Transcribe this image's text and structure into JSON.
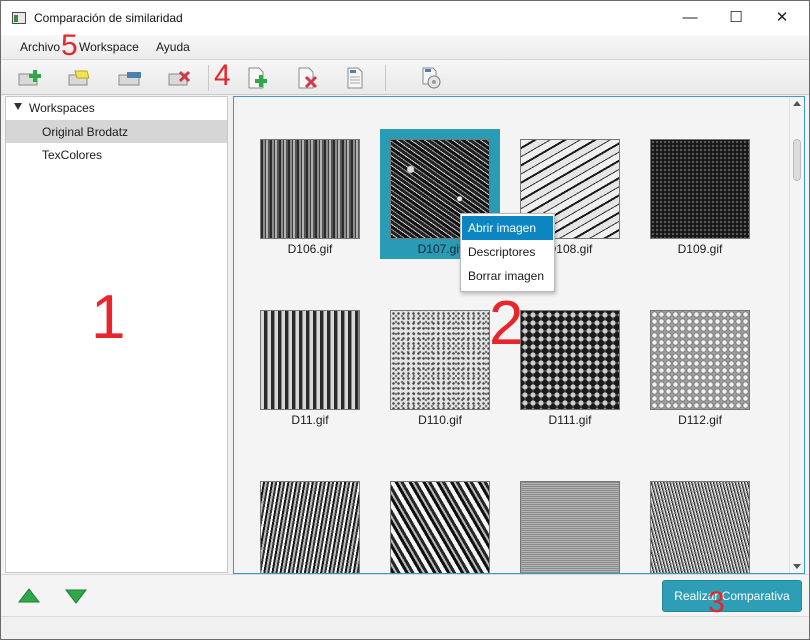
{
  "window": {
    "title": "Comparación de similaridad",
    "minimize_glyph": "—",
    "maximize_glyph": "☐",
    "close_glyph": "✕"
  },
  "menu": {
    "items": [
      {
        "label": "Archivo"
      },
      {
        "label": "Workspace"
      },
      {
        "label": "Ayuda"
      }
    ]
  },
  "toolbar": {
    "buttons": [
      {
        "icon": "add-workspace-icon"
      },
      {
        "icon": "open-folder-icon"
      },
      {
        "icon": "edit-workspace-icon"
      },
      {
        "icon": "delete-workspace-icon"
      },
      {
        "icon": "add-image-icon"
      },
      {
        "icon": "delete-image-icon"
      },
      {
        "icon": "document-icon"
      },
      {
        "icon": "compare-tool-icon"
      }
    ]
  },
  "tree": {
    "root_label": "Workspaces",
    "items": [
      {
        "label": "Original Brodatz",
        "selected": true
      },
      {
        "label": "TexColores",
        "selected": false
      }
    ]
  },
  "gallery": {
    "images": [
      {
        "caption": "D106.gif",
        "selected": false
      },
      {
        "caption": "D107.gif",
        "selected": true
      },
      {
        "caption": "D108.gif",
        "selected": false
      },
      {
        "caption": "D109.gif",
        "selected": false
      },
      {
        "caption": "D11.gif",
        "selected": false
      },
      {
        "caption": "D110.gif",
        "selected": false
      },
      {
        "caption": "D111.gif",
        "selected": false
      },
      {
        "caption": "D112.gif",
        "selected": false
      },
      {
        "caption": "",
        "selected": false
      },
      {
        "caption": "",
        "selected": false
      },
      {
        "caption": "",
        "selected": false
      },
      {
        "caption": "",
        "selected": false
      }
    ]
  },
  "context_menu": {
    "items": [
      {
        "label": "Abrir imagen",
        "active": true
      },
      {
        "label": "Descriptores",
        "active": false
      },
      {
        "label": "Borrar imagen",
        "active": false
      }
    ]
  },
  "bottom": {
    "compare_button": "Realizar Comparativa",
    "up_icon": "arrow-up-icon",
    "down_icon": "arrow-down-icon"
  },
  "annotations": [
    "1",
    "2",
    "3",
    "4",
    "5"
  ],
  "colors": {
    "accent": "#2e9db6",
    "selection": "#2a9bb4",
    "menu_highlight": "#0b86c2",
    "annotation": "#e8252b",
    "green_icon": "#2ea84a",
    "red_icon": "#d23a4b"
  }
}
